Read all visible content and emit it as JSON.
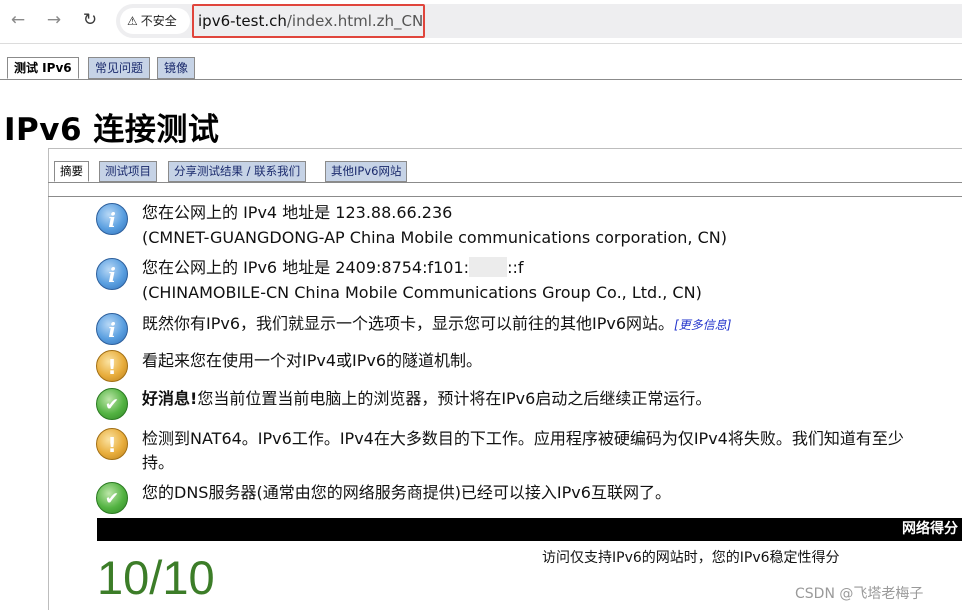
{
  "browser": {
    "security_label": "不安全",
    "url_host": "ipv6-test.ch",
    "url_path": "/index.html.zh_CN"
  },
  "top_tabs": [
    {
      "label": "测试 IPv6",
      "active": true
    },
    {
      "label": "常见问题",
      "active": false
    },
    {
      "label": "镜像",
      "active": false
    }
  ],
  "page_title": "IPv6 连接测试",
  "sub_tabs": [
    {
      "label": "摘要",
      "active": true
    },
    {
      "label": "测试项目",
      "active": false
    },
    {
      "label": "分享测试结果 / 联系我们",
      "active": false
    },
    {
      "label": "其他IPv6网站",
      "active": false
    }
  ],
  "messages": [
    {
      "type": "info",
      "line1": "您在公网上的 IPv4 地址是 123.88.66.236",
      "line2": "(CMNET-GUANGDONG-AP China Mobile communications corporation, CN)"
    },
    {
      "type": "info",
      "line1_prefix": "您在公网上的 IPv6 地址是 2409:8754:f101:",
      "line1_suffix": "::f",
      "line2": "(CHINAMOBILE-CN China Mobile Communications Group Co., Ltd., CN)"
    },
    {
      "type": "info",
      "line1": "既然你有IPv6，我们就显示一个选项卡，显示您可以前往的其他IPv6网站。",
      "link": "[更多信息]"
    },
    {
      "type": "warn",
      "line1": "看起来您在使用一个对IPv4或IPv6的隧道机制。"
    },
    {
      "type": "ok",
      "bold": "好消息!",
      "line1": "您当前位置当前电脑上的浏览器，预计将在IPv6启动之后继续正常运行。"
    },
    {
      "type": "warn",
      "line1": "检测到NAT64。IPv6工作。IPv4在大多数目的下工作。应用程序被硬编码为仅IPv4将失败。我们知道有至少",
      "line2": "持。"
    },
    {
      "type": "ok",
      "line1": "您的DNS服务器(通常由您的网络服务商提供)已经可以接入IPv6互联网了。"
    }
  ],
  "score": {
    "bar_label": "网络得分",
    "value": "10/10",
    "description": "访问仅支持IPv6的网站时，您的IPv6稳定性得分"
  },
  "watermark": "CSDN @飞塔老梅子"
}
